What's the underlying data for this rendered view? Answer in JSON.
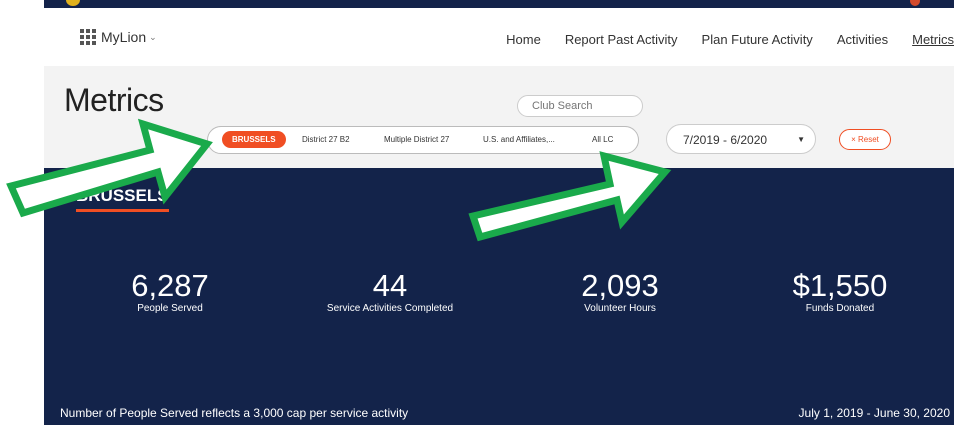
{
  "nav": {
    "brand": "MyLion",
    "items": [
      "Home",
      "Report Past Activity",
      "Plan Future Activity",
      "Activities",
      "Metrics"
    ],
    "active": "Metrics"
  },
  "header": {
    "title": "Metrics",
    "club_search_placeholder": "Club Search",
    "scope_items": [
      "BRUSSELS",
      "District 27 B2",
      "Multiple District 27",
      "U.S. and Affiliates,...",
      "All LC"
    ],
    "date_range": "7/2019 - 6/2020",
    "reset_label": "× Reset"
  },
  "panel": {
    "title": "BRUSSELS",
    "stats": [
      {
        "value": "6,287",
        "label": "People Served"
      },
      {
        "value": "44",
        "label": "Service Activities Completed"
      },
      {
        "value": "2,093",
        "label": "Volunteer Hours"
      },
      {
        "value": "$1,550",
        "label": "Funds Donated"
      }
    ],
    "footnote": "Number of People Served reflects a 3,000 cap per service activity",
    "period": "July 1, 2019 - June 30, 2020"
  },
  "colors": {
    "navy": "#13234a",
    "accent": "#f04e23",
    "arrow": "#1aaa4b"
  }
}
